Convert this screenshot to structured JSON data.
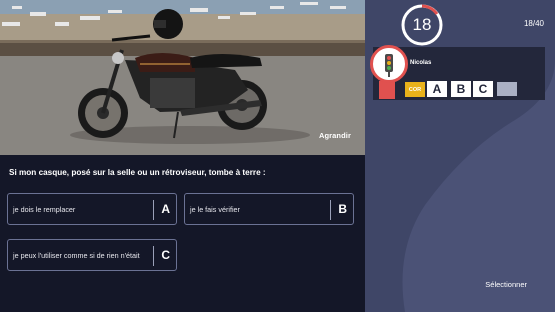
{
  "media": {
    "enlarge_label": "Agrandir"
  },
  "question": {
    "text": "Si mon casque, posé sur la selle ou un rétroviseur, tombe à terre :"
  },
  "answers": [
    {
      "text": "je dois le remplacer",
      "letter": "A"
    },
    {
      "text": "je le fais vérifier",
      "letter": "B"
    },
    {
      "text": "je peux l'utiliser comme si de rien n'était",
      "letter": "C"
    }
  ],
  "timer": {
    "value": "18",
    "ring_color": "#e0514f",
    "track_color": "#ffffff"
  },
  "progress": {
    "label": "18/40"
  },
  "player": {
    "name": "Nicolas",
    "badge": "COR",
    "chips": [
      "A",
      "B",
      "C"
    ],
    "accent_color": "#e0514f",
    "badge_color": "#e9b21a",
    "avatar_icon": "traffic-light-icon"
  },
  "actions": {
    "select_label": "Sélectionner"
  }
}
